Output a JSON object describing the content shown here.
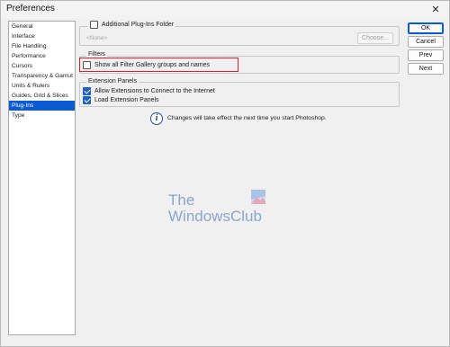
{
  "window": {
    "title": "Preferences",
    "close_glyph": "✕"
  },
  "sidebar": {
    "items": [
      {
        "label": "General"
      },
      {
        "label": "Interface"
      },
      {
        "label": "File Handling"
      },
      {
        "label": "Performance"
      },
      {
        "label": "Cursors"
      },
      {
        "label": "Transparency & Gamut"
      },
      {
        "label": "Units & Rulers"
      },
      {
        "label": "Guides, Grid & Slices"
      },
      {
        "label": "Plug-Ins",
        "selected": true
      },
      {
        "label": "Type"
      }
    ]
  },
  "plugins_folder": {
    "label": "Additional Plug-Ins Folder",
    "checked": false,
    "path": "<None>",
    "choose_label": "Choose..."
  },
  "filters": {
    "title": "Filters",
    "option_label": "Show all Filter Gallery groups and names",
    "checked": false
  },
  "extension_panels": {
    "title": "Extension Panels",
    "options": [
      {
        "label": "Allow Extensions to Connect to the Internet",
        "checked": true
      },
      {
        "label": "Load Extension Panels",
        "checked": true
      }
    ]
  },
  "info": {
    "icon": "info-icon",
    "glyph": "i",
    "text": "Changes will take effect the next time you start Photoshop."
  },
  "buttons": {
    "ok": "OK",
    "cancel": "Cancel",
    "prev": "Prev",
    "next": "Next"
  },
  "watermark": {
    "line1": "The",
    "line2": "WindowsClub"
  },
  "colors": {
    "accent": "#0a5bd3",
    "highlight": "#d6202a",
    "watermark": "#7f9dc8"
  }
}
